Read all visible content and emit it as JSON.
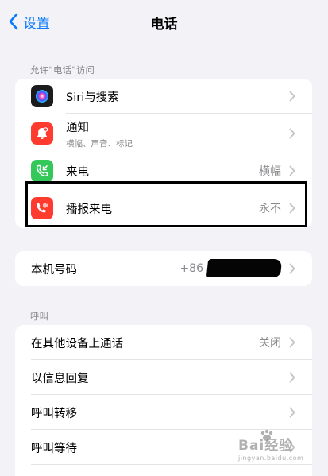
{
  "nav": {
    "back_label": "设置",
    "title": "电话"
  },
  "section_access": {
    "header": "允许“电话”访问",
    "items": [
      {
        "label": "Siri与搜索",
        "sublabel": "",
        "value": "",
        "icon": "siri-icon",
        "icon_color": "#1c1c1e"
      },
      {
        "label": "通知",
        "sublabel": "横幅、声音、标记",
        "value": "",
        "icon": "bell-icon",
        "icon_color": "#ff3b30"
      },
      {
        "label": "来电",
        "sublabel": "",
        "value": "横幅",
        "icon": "phone-incoming-icon",
        "icon_color": "#34c759"
      },
      {
        "label": "播报来电",
        "sublabel": "",
        "value": "永不",
        "icon": "phone-speaker-icon",
        "icon_color": "#ff3b30"
      }
    ]
  },
  "my_number": {
    "label": "本机号码",
    "value_prefix": "+86"
  },
  "section_calls": {
    "header": "呼叫",
    "items": [
      {
        "label": "在其他设备上通话",
        "value": "关闭"
      },
      {
        "label": "以信息回复",
        "value": ""
      },
      {
        "label": "呼叫转移",
        "value": ""
      },
      {
        "label": "呼叫等待",
        "value": ""
      }
    ]
  },
  "watermark": {
    "text": "Bai经验",
    "url": "jingyan.baidu.com"
  },
  "colors": {
    "accent": "#0a7aff",
    "background": "#f2f2f7",
    "secondary_text": "#8a8a8e",
    "highlight_box": "#000000"
  }
}
